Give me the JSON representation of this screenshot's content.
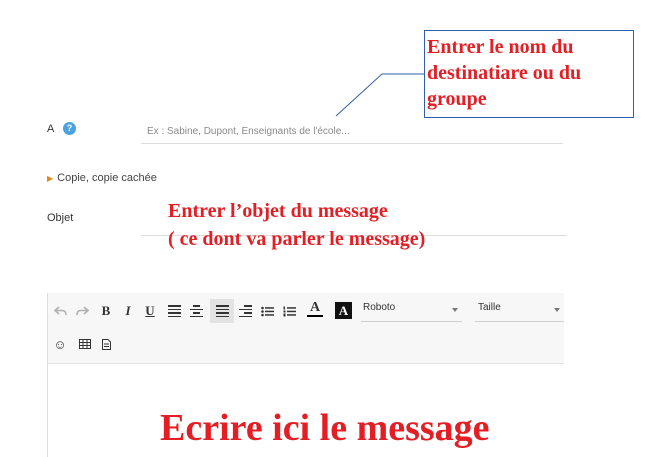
{
  "form": {
    "to": {
      "label": "A",
      "help": "?",
      "placeholder": "Ex : Sabine, Dupont, Enseignants de l'école..."
    },
    "cc_toggle": {
      "label": "Copie, copie cachée"
    },
    "subject": {
      "label": "Objet"
    }
  },
  "toolbar": {
    "font_select": "Roboto",
    "size_select": "Taille",
    "bold": "B",
    "italic": "I",
    "underline": "U",
    "text_color": "A",
    "bg_color": "A",
    "emoji": "☺",
    "table": "▦",
    "file": "🗎"
  },
  "annotations": {
    "recipient": "Entrer le nom du destinatiare ou du groupe",
    "subject_line1": "Entrer l’objet du message",
    "subject_line2": "( ce dont va parler le message)",
    "message": "Ecrire ici le message"
  },
  "colors": {
    "annotation": "#e31e24",
    "callout_border": "#2e5fa8",
    "help_badge": "#4aa3df",
    "cc_arrow": "#e08a1e"
  }
}
